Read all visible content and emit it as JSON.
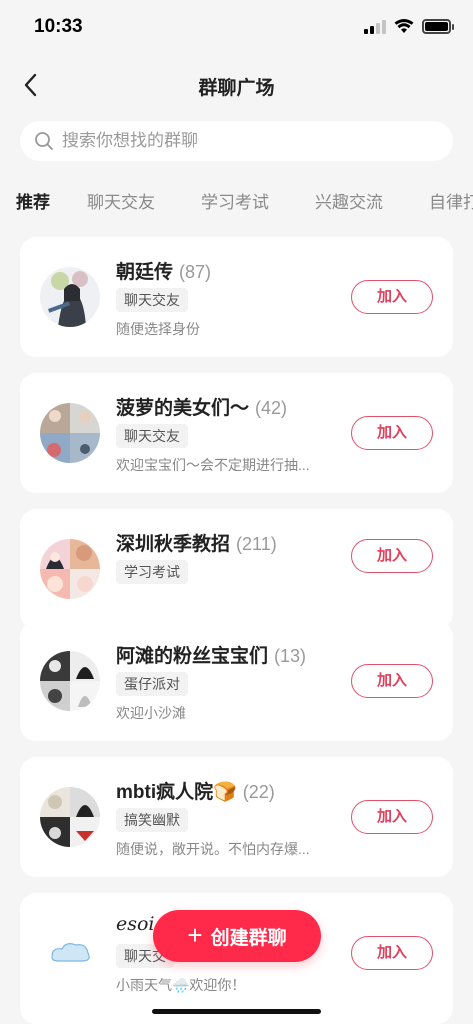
{
  "status_bar": {
    "time": "10:33"
  },
  "nav": {
    "title": "群聊广场"
  },
  "search": {
    "placeholder": "搜索你想找的群聊"
  },
  "tabs": [
    {
      "label": "推荐"
    },
    {
      "label": "聊天交友"
    },
    {
      "label": "学习考试"
    },
    {
      "label": "兴趣交流"
    },
    {
      "label": "自律打"
    }
  ],
  "groups": [
    {
      "name": "朝廷传",
      "count": "(87)",
      "tag": "聊天交友",
      "desc": "随便选择身份",
      "join": "加入"
    },
    {
      "name": "菠萝的美女们～",
      "count": "(42)",
      "tag": "聊天交友",
      "desc": "欢迎宝宝们～会不定期进行抽...",
      "join": "加入"
    },
    {
      "name": "深圳秋季教招",
      "count": "(211)",
      "tag": "学习考试",
      "desc": "",
      "join": "加入"
    },
    {
      "name": "阿滩的粉丝宝宝们",
      "count": "(13)",
      "tag": "蛋仔派对",
      "desc": "欢迎小沙滩",
      "join": "加入"
    },
    {
      "name": "mbti疯人院🍞",
      "count": "(22)",
      "tag": "搞笑幽默",
      "desc": "随便说，敞开说。不怕内存爆...",
      "join": "加入"
    },
    {
      "name": "esoi",
      "count": "",
      "tag": "聊天交",
      "desc": "小雨天气🌧️欢迎你！",
      "join": "加入"
    }
  ],
  "fab": {
    "plus": "+",
    "label": "创建群聊"
  },
  "colors": {
    "accent": "#ff2a4a",
    "background": "#f5f5f5"
  }
}
